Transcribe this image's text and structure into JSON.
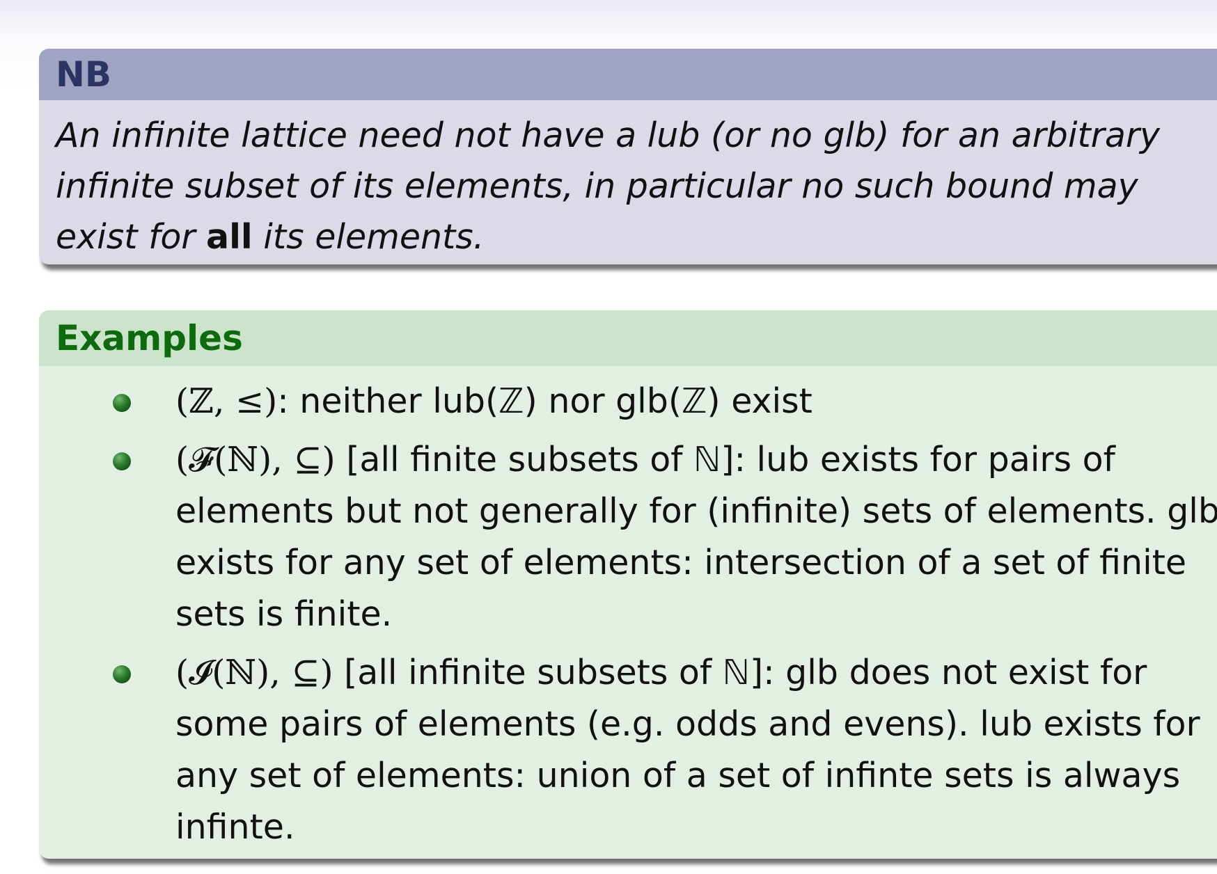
{
  "nb": {
    "title": "NB",
    "lines": [
      "An infinite lattice need not have a lub (or no glb) for an arbitrary",
      "infinite subset of its elements, in particular no such bound may"
    ],
    "line3_pre": "exist for ",
    "line3_bold": "all",
    "line3_post": " its elements."
  },
  "examples": {
    "title": "Examples",
    "items": [
      {
        "math": "(ℤ, ≤)",
        "lines": [
          ": neither lub(ℤ) nor glb(ℤ) exist"
        ]
      },
      {
        "math": "(𝓕(ℕ), ⊆)",
        "lines": [
          " [all finite subsets of ℕ]: lub exists for pairs of",
          "elements but not generally for (infinite) sets of elements. glb",
          "exists for any set of elements: intersection of a set of finite",
          "sets is finite."
        ]
      },
      {
        "math": "(𝓘(ℕ), ⊆)",
        "lines": [
          " [all infinite subsets of ℕ]: glb does not exist for",
          "some pairs of elements (e.g. odds and evens). lub exists for",
          "any set of elements: union of a set of infinte sets is always",
          "infinte."
        ]
      }
    ]
  }
}
